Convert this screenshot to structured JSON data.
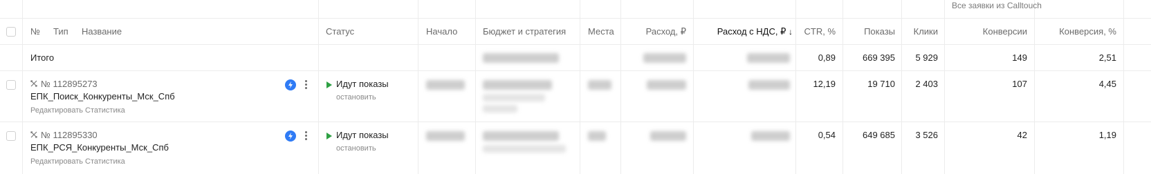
{
  "top_header": {
    "calltouch": "Все заявки из Calltouch"
  },
  "columns": {
    "number": "№",
    "type": "Тип",
    "name": "Название",
    "status": "Статус",
    "start": "Начало",
    "budget": "Бюджет и стратегия",
    "places": "Места",
    "spend": "Расход, ₽",
    "spend_vat": "Расход с НДС, ₽",
    "spend_vat_sort": "↓",
    "ctr": "CTR, %",
    "impressions": "Показы",
    "clicks": "Клики",
    "conversions": "Конверсии",
    "conversion_rate": "Конверсия, %"
  },
  "total": {
    "label": "Итого",
    "ctr": "0,89",
    "impressions": "669 395",
    "clicks": "5 929",
    "conversions": "149",
    "conversion_rate": "2,51"
  },
  "rows": [
    {
      "id": "№ 112895273",
      "name": "ЕПК_Поиск_Конкуренты_Мск_Спб",
      "edit": "Редактировать",
      "stats": "Статистика",
      "status": "Идут показы",
      "stop": "остановить",
      "ctr": "12,19",
      "impressions": "19 710",
      "clicks": "2 403",
      "conversions": "107",
      "conversion_rate": "4,45"
    },
    {
      "id": "№ 112895330",
      "name": "ЕПК_РСЯ_Конкуренты_Мск_Спб",
      "edit": "Редактировать",
      "stats": "Статистика",
      "status": "Идут показы",
      "stop": "остановить",
      "ctr": "0,54",
      "impressions": "649 685",
      "clicks": "3 526",
      "conversions": "42",
      "conversion_rate": "1,19"
    }
  ],
  "colors": {
    "accent_blue": "#2f7bf5",
    "status_green": "#2ea043",
    "grid": "#ececec"
  }
}
